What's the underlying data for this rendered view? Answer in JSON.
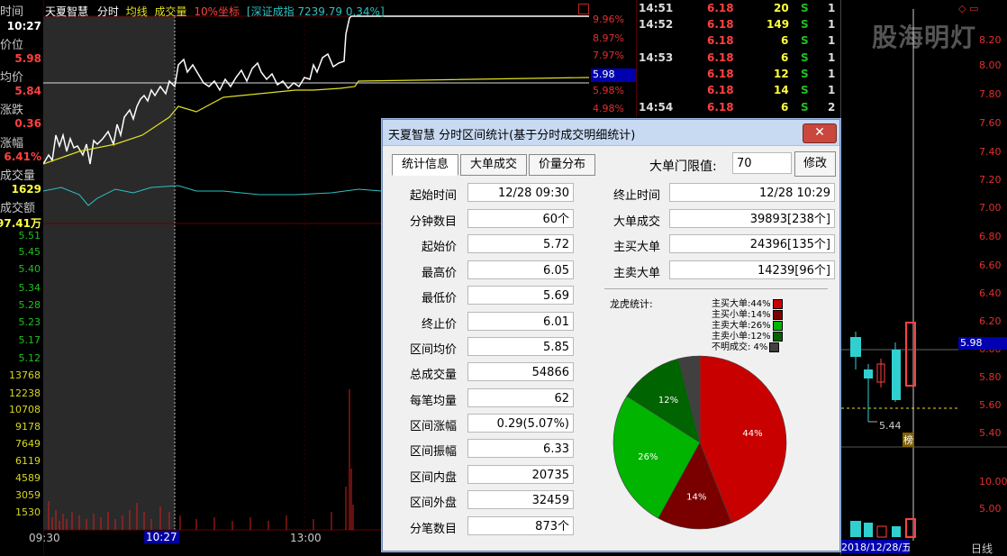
{
  "left_panel": {
    "time_label": "时间",
    "time_value": "10:27",
    "price_label": "价位",
    "price_value": "5.98",
    "avg_label": "均价",
    "avg_value": "5.84",
    "change_label": "涨跌",
    "change_value": "0.36",
    "pct_label": "涨幅",
    "pct_value": "6.41%",
    "vol_label": "成交量",
    "vol_value": "1629",
    "amount_label": "成交额",
    "amount_value": "97.41万",
    "price_axis": [
      "5.51",
      "5.45",
      "5.40",
      "5.34",
      "5.28",
      "5.23",
      "5.17",
      "5.12"
    ],
    "vol_axis": [
      "13768",
      "12238",
      "10708",
      "9178",
      "7649",
      "6119",
      "4589",
      "3059",
      "1530"
    ]
  },
  "chart_header": {
    "stock": "天夏智慧",
    "mode": "分时",
    "avg_line": "均线",
    "volume": "成交量",
    "scale": "10%坐标",
    "index": "[深证成指 7239.79 0.34%]"
  },
  "right_pct_axis": [
    "9.96%",
    "8.97%",
    "7.97%",
    "6.98%",
    "5.98%",
    "4.98%"
  ],
  "current_price_tag": "5.98",
  "time_axis": [
    "09:30",
    "10:27",
    "13:00"
  ],
  "ticks": [
    {
      "time": "14:51",
      "price": "6.18",
      "vol": "20",
      "side": "S",
      "n": "1"
    },
    {
      "time": "14:52",
      "price": "6.18",
      "vol": "149",
      "side": "S",
      "n": "1"
    },
    {
      "time": "",
      "price": "6.18",
      "vol": "6",
      "side": "S",
      "n": "1"
    },
    {
      "time": "14:53",
      "price": "6.18",
      "vol": "6",
      "side": "S",
      "n": "1"
    },
    {
      "time": "",
      "price": "6.18",
      "vol": "12",
      "side": "S",
      "n": "1"
    },
    {
      "time": "",
      "price": "6.18",
      "vol": "14",
      "side": "S",
      "n": "1"
    },
    {
      "time": "14:54",
      "price": "6.18",
      "vol": "6",
      "side": "S",
      "n": "2"
    }
  ],
  "kchart": {
    "watermark": "股海明灯",
    "axis": [
      "8.20",
      "8.00",
      "7.80",
      "7.60",
      "7.40",
      "7.20",
      "7.00",
      "6.80",
      "6.60",
      "6.40",
      "6.20",
      "6.00",
      "5.80",
      "5.60",
      "5.40"
    ],
    "price_tag": "5.98",
    "low_label": "5.44",
    "badge": "榜",
    "vol_axis": [
      "10.00",
      "5.00"
    ],
    "date_label": "2018/12/28/五",
    "period": "日线",
    "marker": "◇ ▭"
  },
  "dialog": {
    "title": "天夏智慧 分时区间统计(基于分时成交明细统计)",
    "close": "✕",
    "tabs": [
      "统计信息",
      "大单成交",
      "价量分布"
    ],
    "threshold_label": "大单门限值:",
    "threshold_value": "70",
    "modify_button": "修改",
    "left_rows": [
      {
        "label": "起始时间",
        "value": "12/28 09:30"
      },
      {
        "label": "分钟数目",
        "value": "60个"
      },
      {
        "label": "起始价",
        "value": "5.72"
      },
      {
        "label": "最高价",
        "value": "6.05"
      },
      {
        "label": "最低价",
        "value": "5.69"
      },
      {
        "label": "终止价",
        "value": "6.01"
      },
      {
        "label": "区间均价",
        "value": "5.85"
      },
      {
        "label": "总成交量",
        "value": "54866"
      },
      {
        "label": "每笔均量",
        "value": "62"
      },
      {
        "label": "区间涨幅",
        "value": "0.29(5.07%)"
      },
      {
        "label": "区间振幅",
        "value": "6.33"
      },
      {
        "label": "区间内盘",
        "value": "20735"
      },
      {
        "label": "区间外盘",
        "value": "32459"
      },
      {
        "label": "分笔数目",
        "value": "873个"
      }
    ],
    "right_rows": [
      {
        "label": "终止时间",
        "value": "12/28 10:29"
      },
      {
        "label": "大单成交",
        "value": "39893[238个]"
      },
      {
        "label": "主买大单",
        "value": "24396[135个]"
      },
      {
        "label": "主卖大单",
        "value": "14239[96个]"
      }
    ],
    "pie_title": "龙虎统计:",
    "pie": [
      {
        "label": "主买大单:44%",
        "pct": 44,
        "text": "44%",
        "color": "#c80000"
      },
      {
        "label": "主买小单:14%",
        "pct": 14,
        "text": "14%",
        "color": "#7a0000"
      },
      {
        "label": "主卖大单:26%",
        "pct": 26,
        "text": "26%",
        "color": "#00b400"
      },
      {
        "label": "主卖小单:12%",
        "pct": 12,
        "text": "12%",
        "color": "#006400"
      },
      {
        "label": "不明成交: 4%",
        "pct": 4,
        "text": "",
        "color": "#404040"
      }
    ]
  }
}
